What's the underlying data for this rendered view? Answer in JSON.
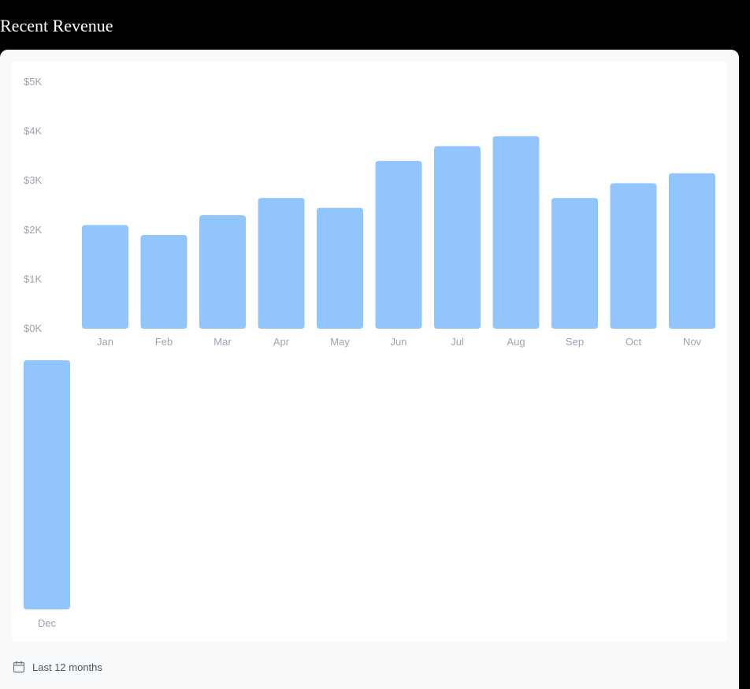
{
  "page": {
    "title": "Recent Revenue"
  },
  "footer": {
    "range_label": "Last 12 months",
    "icon": "calendar-icon"
  },
  "colors": {
    "bar": "#93c5fd",
    "tick_text": "#9ca3af",
    "card_background": "#f8f9fb",
    "panel_background": "#ffffff"
  },
  "chart_data": {
    "type": "bar",
    "title": "",
    "xlabel": "",
    "ylabel": "",
    "categories": [
      "Jan",
      "Feb",
      "Mar",
      "Apr",
      "May",
      "Jun",
      "Jul",
      "Aug",
      "Sep",
      "Oct",
      "Nov",
      "Dec"
    ],
    "values": [
      2100,
      1900,
      2300,
      2650,
      2450,
      3400,
      3700,
      3900,
      2650,
      2950,
      3150,
      5100
    ],
    "y_ticks": [
      "$0K",
      "$1K",
      "$2K",
      "$3K",
      "$4K",
      "$5K"
    ],
    "ylim": [
      0,
      5000
    ],
    "grid": false,
    "legend": "none",
    "wrapping": "Dec wraps onto a second row"
  }
}
